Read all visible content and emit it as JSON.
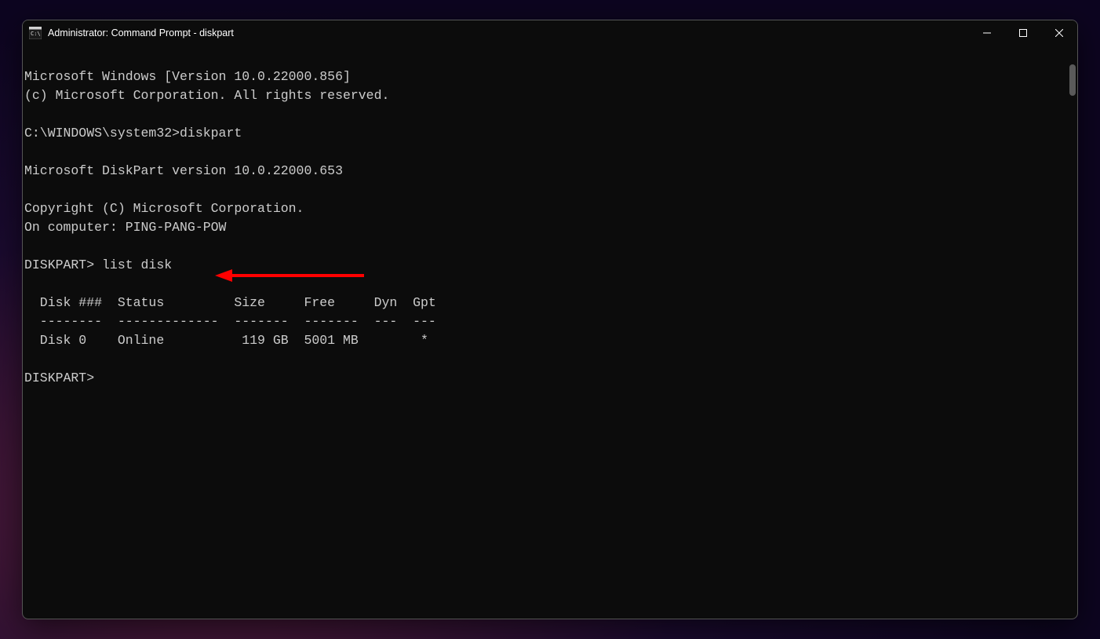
{
  "window": {
    "title": "Administrator: Command Prompt - diskpart"
  },
  "terminal": {
    "line1": "Microsoft Windows [Version 10.0.22000.856]",
    "line2": "(c) Microsoft Corporation. All rights reserved.",
    "blank1": "",
    "line3": "C:\\WINDOWS\\system32>diskpart",
    "blank2": "",
    "line4": "Microsoft DiskPart version 10.0.22000.653",
    "blank3": "",
    "line5": "Copyright (C) Microsoft Corporation.",
    "line6": "On computer: PING-PANG-POW",
    "blank4": "",
    "line7": "DISKPART> list disk",
    "blank5": "",
    "line8": "  Disk ###  Status         Size     Free     Dyn  Gpt",
    "line9": "  --------  -------------  -------  -------  ---  ---",
    "line10": "  Disk 0    Online          119 GB  5001 MB        *",
    "blank6": "",
    "line11": "DISKPART>"
  },
  "annotation": {
    "arrow_color": "#ff0000"
  }
}
